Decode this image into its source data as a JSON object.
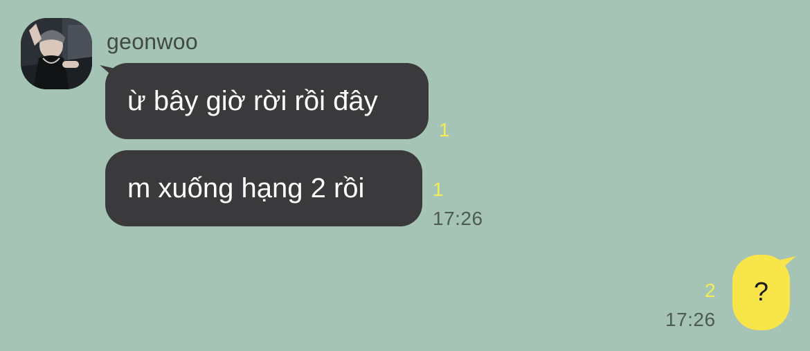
{
  "conversation": {
    "sender": {
      "name": "geonwoo",
      "avatar": "profile-photo"
    },
    "incoming": [
      {
        "text": "ừ bây giờ rời rồi đây",
        "unread": "1"
      },
      {
        "text": "m xuống hạng 2 rồi",
        "unread": "1",
        "time": "17:26"
      }
    ],
    "outgoing": [
      {
        "text": "?",
        "unread": "2",
        "time": "17:26"
      }
    ]
  },
  "colors": {
    "background": "#a6c4b5",
    "incoming_bubble": "#3a3a3c",
    "outgoing_bubble": "#f8e54a",
    "unread_count": "#f4ec57",
    "timestamp": "#4d5a55"
  }
}
